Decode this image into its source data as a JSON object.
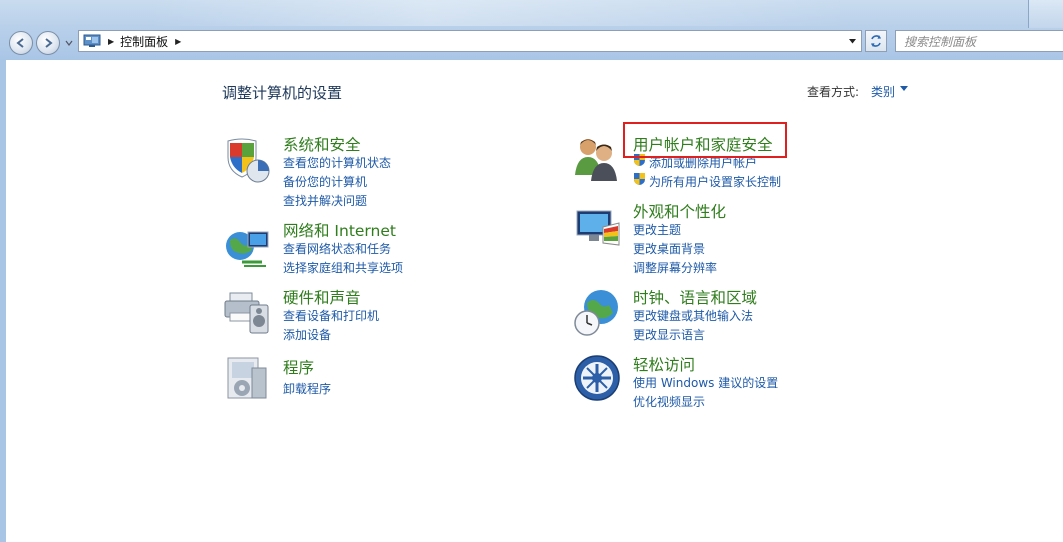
{
  "window": {
    "breadcrumb": [
      "控制面板"
    ],
    "search_placeholder": "搜索控制面板"
  },
  "header": {
    "title": "调整计算机的设置",
    "view_by_label": "查看方式:",
    "view_by_value": "类别"
  },
  "categories": [
    {
      "title": "系统和安全",
      "icon": "system-security-icon",
      "links": [
        "查看您的计算机状态",
        "备份您的计算机",
        "查找并解决问题"
      ]
    },
    {
      "title": "网络和 Internet",
      "icon": "network-icon",
      "links": [
        "查看网络状态和任务",
        "选择家庭组和共享选项"
      ]
    },
    {
      "title": "硬件和声音",
      "icon": "hardware-sound-icon",
      "links": [
        "查看设备和打印机",
        "添加设备"
      ]
    },
    {
      "title": "程序",
      "icon": "programs-icon",
      "links": [
        "卸载程序"
      ]
    },
    {
      "title": "用户帐户和家庭安全",
      "icon": "user-accounts-icon",
      "links": [
        "添加或删除用户帐户",
        "为所有用户设置家长控制"
      ]
    },
    {
      "title": "外观和个性化",
      "icon": "appearance-icon",
      "links": [
        "更改主题",
        "更改桌面背景",
        "调整屏幕分辨率"
      ]
    },
    {
      "title": "时钟、语言和区域",
      "icon": "clock-region-icon",
      "links": [
        "更改键盘或其他输入法",
        "更改显示语言"
      ]
    },
    {
      "title": "轻松访问",
      "icon": "ease-of-access-icon",
      "links": [
        "使用 Windows 建议的设置",
        "优化视频显示"
      ]
    }
  ],
  "colors": {
    "category_title": "#2f7d1c",
    "link": "#1e5aa8",
    "highlight": "#e02020"
  }
}
